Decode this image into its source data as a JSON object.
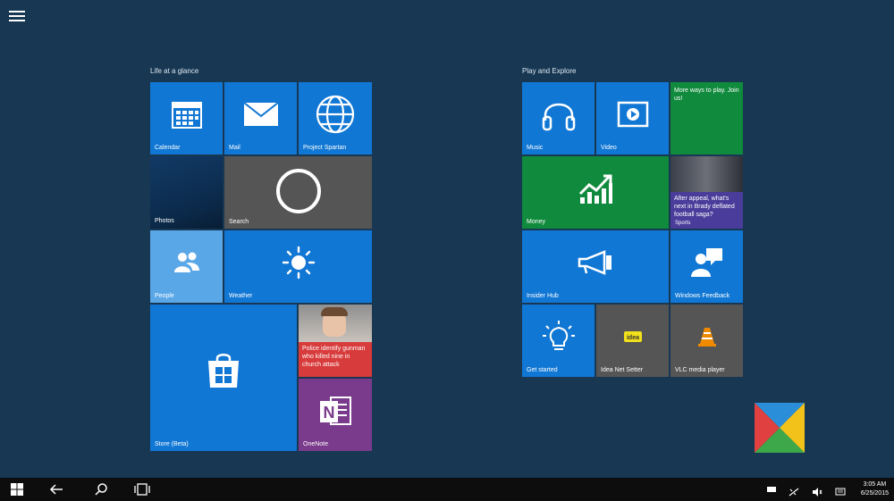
{
  "groups": {
    "left_title": "Life at a glance",
    "right_title": "Play and Explore"
  },
  "tiles": {
    "calendar": "Calendar",
    "mail": "Mail",
    "spartan": "Project Spartan",
    "photos": "Photos",
    "search": "Search",
    "people": "People",
    "weather": "Weather",
    "store": "Store (Beta)",
    "news_left": "Police identify gunman who killed nine in church attack",
    "onenote": "OneNote",
    "music": "Music",
    "video": "Video",
    "more_ways": "More ways to play. Join us!",
    "money": "Money",
    "news_right": "After appeal, what's next in Brady deflated football saga?",
    "sports": "Sports",
    "insider": "Insider Hub",
    "feedback": "Windows Feedback",
    "get_started": "Get started",
    "idea": "Idea Net Setter",
    "vlc": "VLC media player"
  },
  "taskbar": {
    "time": "3:05 AM",
    "date": "6/25/2015"
  },
  "colors": {
    "background": "#173753",
    "tile_blue": "#1177d4",
    "tile_gray": "#555555",
    "tile_green": "#108a3c",
    "tile_red": "#d83b3b",
    "tile_purple": "#7a3b8c",
    "people_blue": "#5aa7e8"
  },
  "icons": [
    "menu-icon",
    "calendar-icon",
    "mail-icon",
    "globe-icon",
    "cortana-icon",
    "people-icon",
    "sun-icon",
    "store-bag-icon",
    "onenote-icon",
    "headphones-icon",
    "video-icon",
    "chart-icon",
    "megaphone-icon",
    "feedback-icon",
    "lightbulb-icon",
    "idea-logo-icon",
    "vlc-cone-icon",
    "windows-logo-icon",
    "back-arrow-icon",
    "search-icon",
    "task-view-icon"
  ]
}
